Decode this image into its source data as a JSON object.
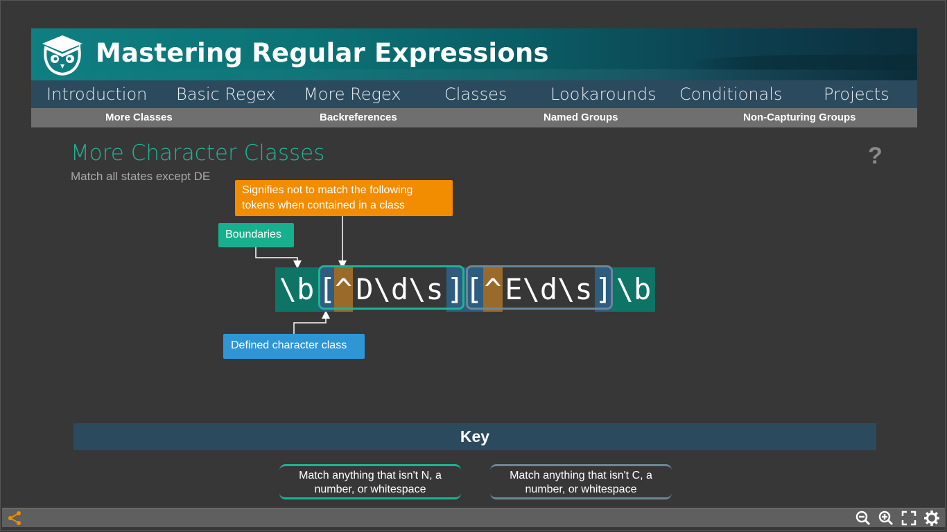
{
  "banner": {
    "title": "Mastering Regular Expressions"
  },
  "nav": {
    "items": [
      "Introduction",
      "Basic Regex",
      "More Regex",
      "Classes",
      "Lookarounds",
      "Conditionals",
      "Projects"
    ]
  },
  "subnav": {
    "items": [
      "More Classes",
      "Backreferences",
      "Named Groups",
      "Non-Capturing Groups"
    ]
  },
  "content": {
    "title": "More Character Classes",
    "subtitle": "Match all states except DE",
    "help_label": "?"
  },
  "callouts": {
    "negation": "Signifies not to match the following tokens when contained in a class",
    "boundaries": "Boundaries",
    "defined_class": "Defined character class"
  },
  "regex": {
    "tokens": [
      "\\b",
      "[",
      "^",
      "D\\d\\s",
      "]",
      "[",
      "^",
      "E\\d\\s",
      "]",
      "\\b"
    ]
  },
  "key": {
    "title": "Key",
    "items": [
      "Match anything that isn't N, a number, or whitespace",
      "Match anything that isn't C, a number, or whitespace"
    ]
  },
  "colors": {
    "accent_teal": "#1ab595",
    "nav_bg": "#2c4a5e",
    "callout_orange": "#f28c00",
    "callout_blue": "#2f96d6",
    "negation_bg": "#9a6a2a"
  },
  "toolbar": {
    "icons": [
      "share-icon",
      "zoom-out-icon",
      "zoom-in-icon",
      "fullscreen-icon",
      "settings-icon"
    ]
  }
}
